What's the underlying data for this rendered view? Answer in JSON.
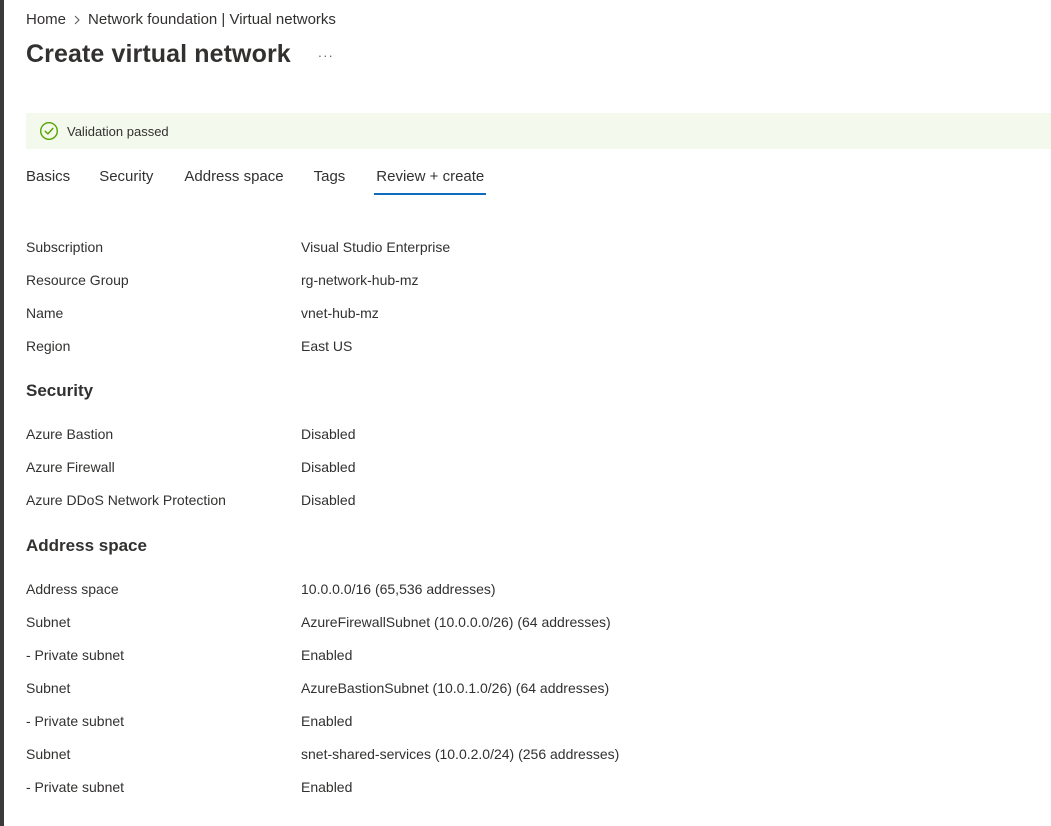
{
  "breadcrumb": {
    "home": "Home",
    "parent": "Network foundation | Virtual networks"
  },
  "page": {
    "title": "Create virtual network",
    "more": "···"
  },
  "banner": {
    "message": "Validation passed",
    "status_color": "#57a300"
  },
  "tabs": [
    {
      "label": "Basics"
    },
    {
      "label": "Security"
    },
    {
      "label": "Address space"
    },
    {
      "label": "Tags"
    },
    {
      "label": "Review + create",
      "active": true
    }
  ],
  "basics": [
    {
      "label": "Subscription",
      "value": "Visual Studio Enterprise"
    },
    {
      "label": "Resource Group",
      "value": "rg-network-hub-mz"
    },
    {
      "label": "Name",
      "value": "vnet-hub-mz"
    },
    {
      "label": "Region",
      "value": "East US"
    }
  ],
  "security": {
    "title": "Security",
    "rows": [
      {
        "label": "Azure Bastion",
        "value": "Disabled"
      },
      {
        "label": "Azure Firewall",
        "value": "Disabled"
      },
      {
        "label": "Azure DDoS Network Protection",
        "value": "Disabled"
      }
    ]
  },
  "address_space": {
    "title": "Address space",
    "rows": [
      {
        "label": "Address space",
        "value": "10.0.0.0/16 (65,536 addresses)"
      },
      {
        "label": "Subnet",
        "value": "AzureFirewallSubnet (10.0.0.0/26) (64 addresses)"
      },
      {
        "label": "- Private subnet",
        "value": "Enabled"
      },
      {
        "label": "Subnet",
        "value": "AzureBastionSubnet (10.0.1.0/26) (64 addresses)"
      },
      {
        "label": "- Private subnet",
        "value": "Enabled"
      },
      {
        "label": "Subnet",
        "value": "snet-shared-services (10.0.2.0/24) (256 addresses)"
      },
      {
        "label": "- Private subnet",
        "value": "Enabled"
      }
    ]
  },
  "theme": {
    "accent": "#0f6cbd",
    "banner_bg": "#f4f9ee",
    "text": "#323130"
  }
}
